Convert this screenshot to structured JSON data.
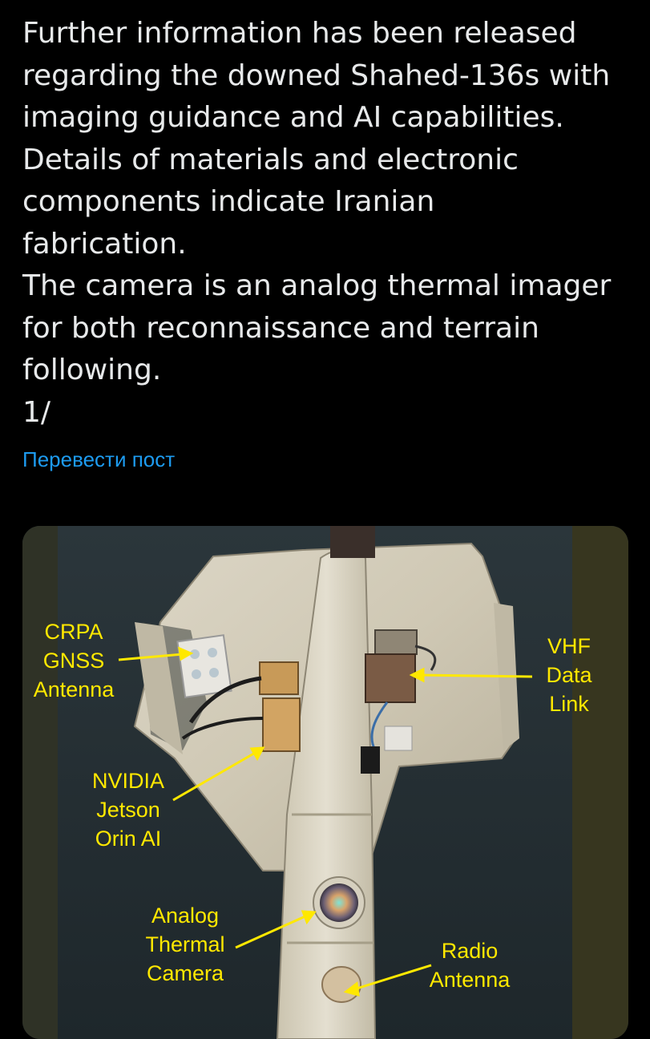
{
  "post": {
    "lines": [
      "Further information has been released",
      "regarding the downed Shahed-136s with",
      "imaging guidance and AI capabilities.",
      "Details of materials and electronic",
      "components indicate Iranian",
      "fabrication.",
      "The camera is an analog thermal imager",
      "for both reconnaissance and terrain",
      "following.",
      "1/"
    ],
    "translate_link": "Перевести пост"
  },
  "image": {
    "labels": {
      "crpa": [
        "CRPA",
        "GNSS",
        "Antenna"
      ],
      "vhf": [
        "VHF",
        "Data",
        "Link"
      ],
      "nvidia": [
        "NVIDIA",
        "Jetson",
        "Orin AI"
      ],
      "camera": [
        "Analog",
        "Thermal",
        "Camera"
      ],
      "radio": [
        "Radio",
        "Antenna"
      ]
    },
    "label_color": "#ffe800"
  },
  "colors": {
    "background": "#000000",
    "text": "#e7e9ea",
    "link": "#1d9bf0"
  }
}
